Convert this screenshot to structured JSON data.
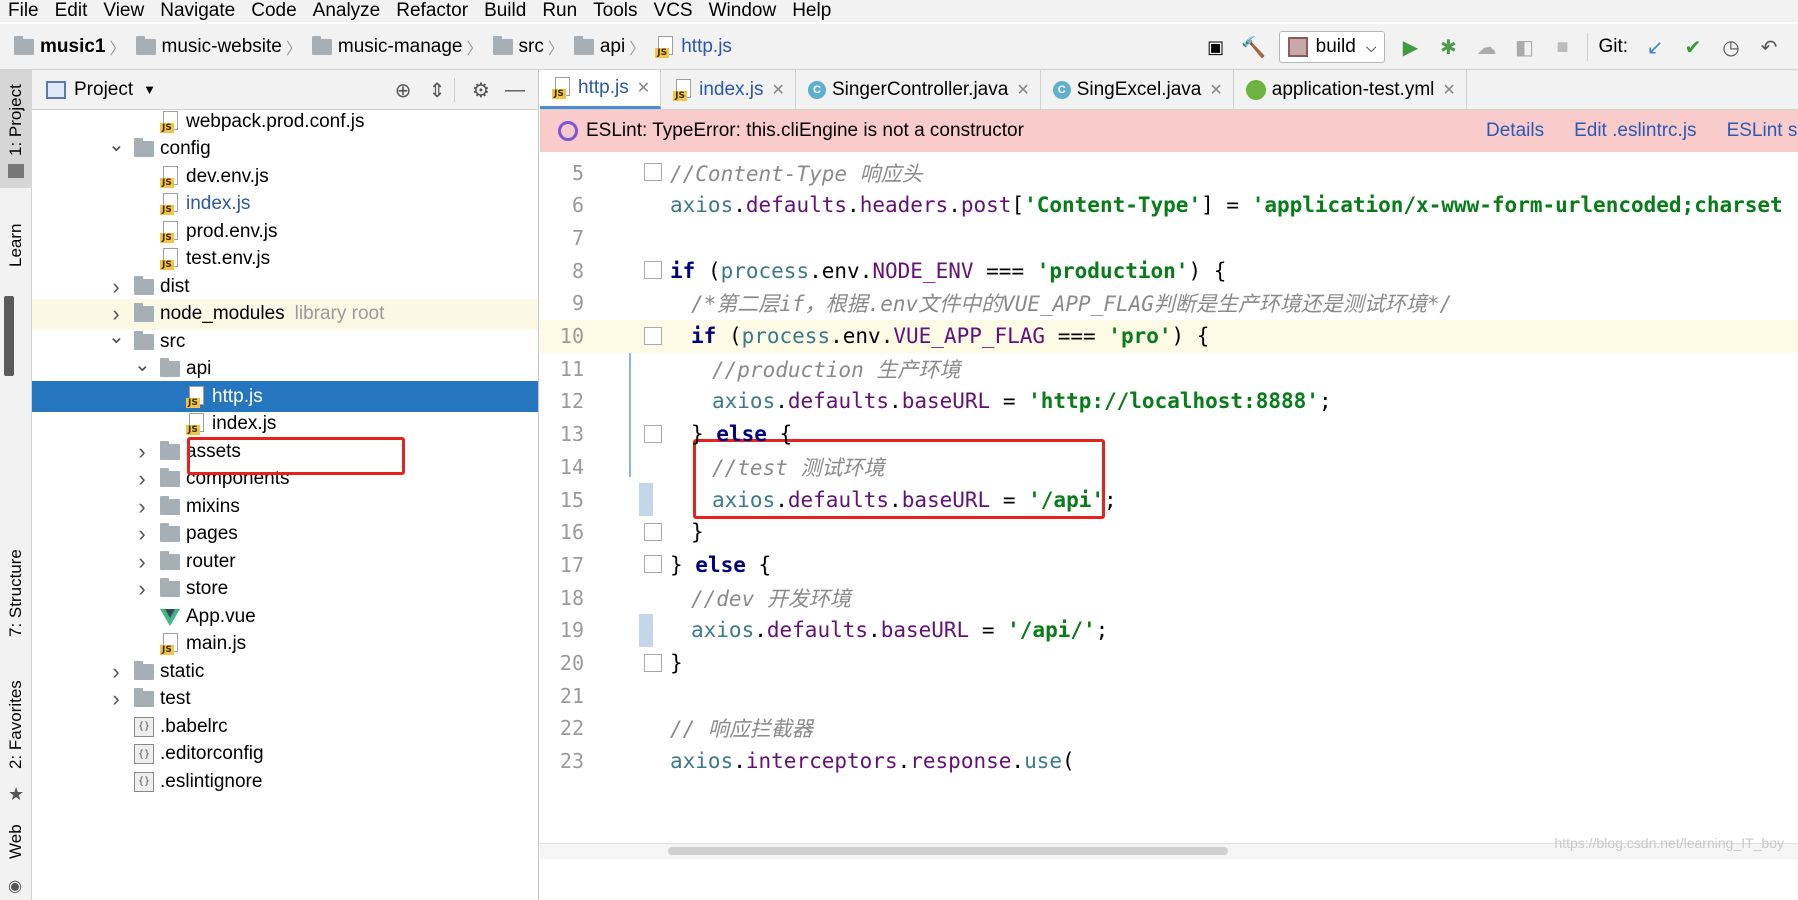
{
  "menu": [
    "File",
    "Edit",
    "View",
    "Navigate",
    "Code",
    "Analyze",
    "Refactor",
    "Build",
    "Run",
    "Tools",
    "VCS",
    "Window",
    "Help"
  ],
  "breadcrumbs": [
    "music1",
    "music-website",
    "music-manage",
    "src",
    "api",
    "http.js"
  ],
  "toolbar": {
    "build_label": "build",
    "git_label": "Git:"
  },
  "left_strip": {
    "project": "1: Project",
    "learn": "Learn",
    "structure": "7: Structure",
    "favorites": "2: Favorites",
    "web": "Web"
  },
  "project_panel": {
    "title": "Project"
  },
  "tree": [
    {
      "label": "webpack.prod.conf.js",
      "type": "js",
      "indent": 4,
      "arrow": ""
    },
    {
      "label": "config",
      "type": "folder",
      "indent": 3,
      "arrow": "open"
    },
    {
      "label": "dev.env.js",
      "type": "js",
      "indent": 4,
      "arrow": ""
    },
    {
      "label": "index.js",
      "type": "js",
      "indent": 4,
      "arrow": "",
      "blue": true
    },
    {
      "label": "prod.env.js",
      "type": "js",
      "indent": 4,
      "arrow": ""
    },
    {
      "label": "test.env.js",
      "type": "js",
      "indent": 4,
      "arrow": ""
    },
    {
      "label": "dist",
      "type": "folder",
      "indent": 3,
      "arrow": "closed"
    },
    {
      "label": "node_modules",
      "type": "folder",
      "indent": 3,
      "arrow": "closed",
      "extra": "library root",
      "hilite": true
    },
    {
      "label": "src",
      "type": "folder",
      "indent": 3,
      "arrow": "open"
    },
    {
      "label": "api",
      "type": "folder",
      "indent": 4,
      "arrow": "open"
    },
    {
      "label": "http.js",
      "type": "js",
      "indent": 5,
      "arrow": "",
      "selected": true
    },
    {
      "label": "index.js",
      "type": "js",
      "indent": 5,
      "arrow": ""
    },
    {
      "label": "assets",
      "type": "folder",
      "indent": 4,
      "arrow": "closed"
    },
    {
      "label": "components",
      "type": "folder",
      "indent": 4,
      "arrow": "closed"
    },
    {
      "label": "mixins",
      "type": "folder",
      "indent": 4,
      "arrow": "closed"
    },
    {
      "label": "pages",
      "type": "folder",
      "indent": 4,
      "arrow": "closed"
    },
    {
      "label": "router",
      "type": "folder",
      "indent": 4,
      "arrow": "closed"
    },
    {
      "label": "store",
      "type": "folder",
      "indent": 4,
      "arrow": "closed"
    },
    {
      "label": "App.vue",
      "type": "vue",
      "indent": 4,
      "arrow": ""
    },
    {
      "label": "main.js",
      "type": "js",
      "indent": 4,
      "arrow": ""
    },
    {
      "label": "static",
      "type": "folder",
      "indent": 3,
      "arrow": "closed"
    },
    {
      "label": "test",
      "type": "folder",
      "indent": 3,
      "arrow": "closed"
    },
    {
      "label": ".babelrc",
      "type": "cfg",
      "indent": 3,
      "arrow": ""
    },
    {
      "label": ".editorconfig",
      "type": "cfg",
      "indent": 3,
      "arrow": ""
    },
    {
      "label": ".eslintignore",
      "type": "cfg",
      "indent": 3,
      "arrow": ""
    }
  ],
  "tabs": [
    {
      "label": "http.js",
      "icon": "js",
      "active": true
    },
    {
      "label": "index.js",
      "icon": "js",
      "active": false
    },
    {
      "label": "SingerController.java",
      "icon": "c",
      "active": false
    },
    {
      "label": "SingExcel.java",
      "icon": "c",
      "active": false
    },
    {
      "label": "application-test.yml",
      "icon": "yml",
      "active": false
    }
  ],
  "eslint": {
    "message": "ESLint: TypeError: this.cliEngine is not a constructor",
    "details": "Details",
    "edit": "Edit .eslintrc.js",
    "settings": "ESLint se"
  },
  "code_lines": [
    {
      "n": "5",
      "indent": 0,
      "tokens": [
        [
          "c-com",
          "//Content-Type 响应头"
        ]
      ],
      "fold": true
    },
    {
      "n": "6",
      "indent": 0,
      "tokens": [
        [
          "c-id",
          "axios"
        ],
        [
          "c-punc",
          "."
        ],
        [
          "c-prop",
          "defaults"
        ],
        [
          "c-punc",
          "."
        ],
        [
          "c-prop",
          "headers"
        ],
        [
          "c-punc",
          "."
        ],
        [
          "c-prop",
          "post"
        ],
        [
          "c-punc",
          "["
        ],
        [
          "c-str",
          "'Content-Type'"
        ],
        [
          "c-punc",
          "] = "
        ],
        [
          "c-str",
          "'application/x-www-form-urlencoded;charset"
        ]
      ]
    },
    {
      "n": "7",
      "indent": 0,
      "tokens": []
    },
    {
      "n": "8",
      "indent": 0,
      "tokens": [
        [
          "c-key",
          "if"
        ],
        [
          "c-punc",
          " ("
        ],
        [
          "c-id",
          "process"
        ],
        [
          "c-punc",
          "."
        ],
        [
          "c-punc",
          "env"
        ],
        [
          "c-punc",
          "."
        ],
        [
          "c-prop",
          "NODE_ENV"
        ],
        [
          "c-punc",
          " === "
        ],
        [
          "c-str",
          "'production'"
        ],
        [
          "c-punc",
          ") {"
        ]
      ],
      "fold": true
    },
    {
      "n": "9",
      "indent": 1,
      "tokens": [
        [
          "c-com",
          "/*第二层if，根据.env文件中的VUE_APP_FLAG判断是生产环境还是测试环境*/"
        ]
      ]
    },
    {
      "n": "10",
      "indent": 1,
      "tokens": [
        [
          "c-key",
          "if"
        ],
        [
          "c-punc",
          " ("
        ],
        [
          "c-id",
          "process"
        ],
        [
          "c-punc",
          "."
        ],
        [
          "c-punc",
          "env"
        ],
        [
          "c-punc",
          "."
        ],
        [
          "c-prop",
          "VUE_APP_FLAG"
        ],
        [
          "c-punc",
          " === "
        ],
        [
          "c-str",
          "'pro'"
        ],
        [
          "c-punc",
          ") {"
        ]
      ],
      "fold": true,
      "current": true
    },
    {
      "n": "11",
      "indent": 2,
      "tokens": [
        [
          "c-com",
          "//production 生产环境"
        ]
      ]
    },
    {
      "n": "12",
      "indent": 2,
      "tokens": [
        [
          "c-id",
          "axios"
        ],
        [
          "c-punc",
          "."
        ],
        [
          "c-prop",
          "defaults"
        ],
        [
          "c-punc",
          "."
        ],
        [
          "c-prop",
          "baseURL"
        ],
        [
          "c-punc",
          " = "
        ],
        [
          "c-str",
          "'http://localhost:8888'"
        ],
        [
          "c-punc",
          ";"
        ]
      ]
    },
    {
      "n": "13",
      "indent": 1,
      "tokens": [
        [
          "c-punc",
          "} "
        ],
        [
          "c-key",
          "else"
        ],
        [
          "c-punc",
          " {"
        ]
      ],
      "fold": true
    },
    {
      "n": "14",
      "indent": 2,
      "tokens": [
        [
          "c-com",
          "//test 测试环境"
        ]
      ]
    },
    {
      "n": "15",
      "indent": 2,
      "tokens": [
        [
          "c-id",
          "axios"
        ],
        [
          "c-punc",
          "."
        ],
        [
          "c-prop",
          "defaults"
        ],
        [
          "c-punc",
          "."
        ],
        [
          "c-prop",
          "baseURL"
        ],
        [
          "c-punc",
          " = "
        ],
        [
          "c-str",
          "'/api'"
        ],
        [
          "c-punc",
          ";"
        ]
      ],
      "change": true
    },
    {
      "n": "16",
      "indent": 1,
      "tokens": [
        [
          "c-punc",
          "}"
        ]
      ],
      "fold": true
    },
    {
      "n": "17",
      "indent": 0,
      "tokens": [
        [
          "c-punc",
          "} "
        ],
        [
          "c-key",
          "else"
        ],
        [
          "c-punc",
          " {"
        ]
      ],
      "fold": true
    },
    {
      "n": "18",
      "indent": 1,
      "tokens": [
        [
          "c-com",
          "//dev 开发环境"
        ]
      ]
    },
    {
      "n": "19",
      "indent": 1,
      "tokens": [
        [
          "c-id",
          "axios"
        ],
        [
          "c-punc",
          "."
        ],
        [
          "c-prop",
          "defaults"
        ],
        [
          "c-punc",
          "."
        ],
        [
          "c-prop",
          "baseURL"
        ],
        [
          "c-punc",
          " = "
        ],
        [
          "c-str",
          "'/api/'"
        ],
        [
          "c-punc",
          ";"
        ]
      ],
      "change": true
    },
    {
      "n": "20",
      "indent": 0,
      "tokens": [
        [
          "c-punc",
          "}"
        ]
      ],
      "fold": true
    },
    {
      "n": "21",
      "indent": 0,
      "tokens": []
    },
    {
      "n": "22",
      "indent": 0,
      "tokens": [
        [
          "c-com",
          "// 响应拦截器"
        ]
      ]
    },
    {
      "n": "23",
      "indent": 0,
      "tokens": [
        [
          "c-id",
          "axios"
        ],
        [
          "c-punc",
          "."
        ],
        [
          "c-prop",
          "interceptors"
        ],
        [
          "c-punc",
          "."
        ],
        [
          "c-prop",
          "response"
        ],
        [
          "c-punc",
          "."
        ],
        [
          "c-id",
          "use"
        ],
        [
          "c-punc",
          "("
        ]
      ]
    }
  ],
  "watermark": "https://blog.csdn.net/learning_IT_boy"
}
